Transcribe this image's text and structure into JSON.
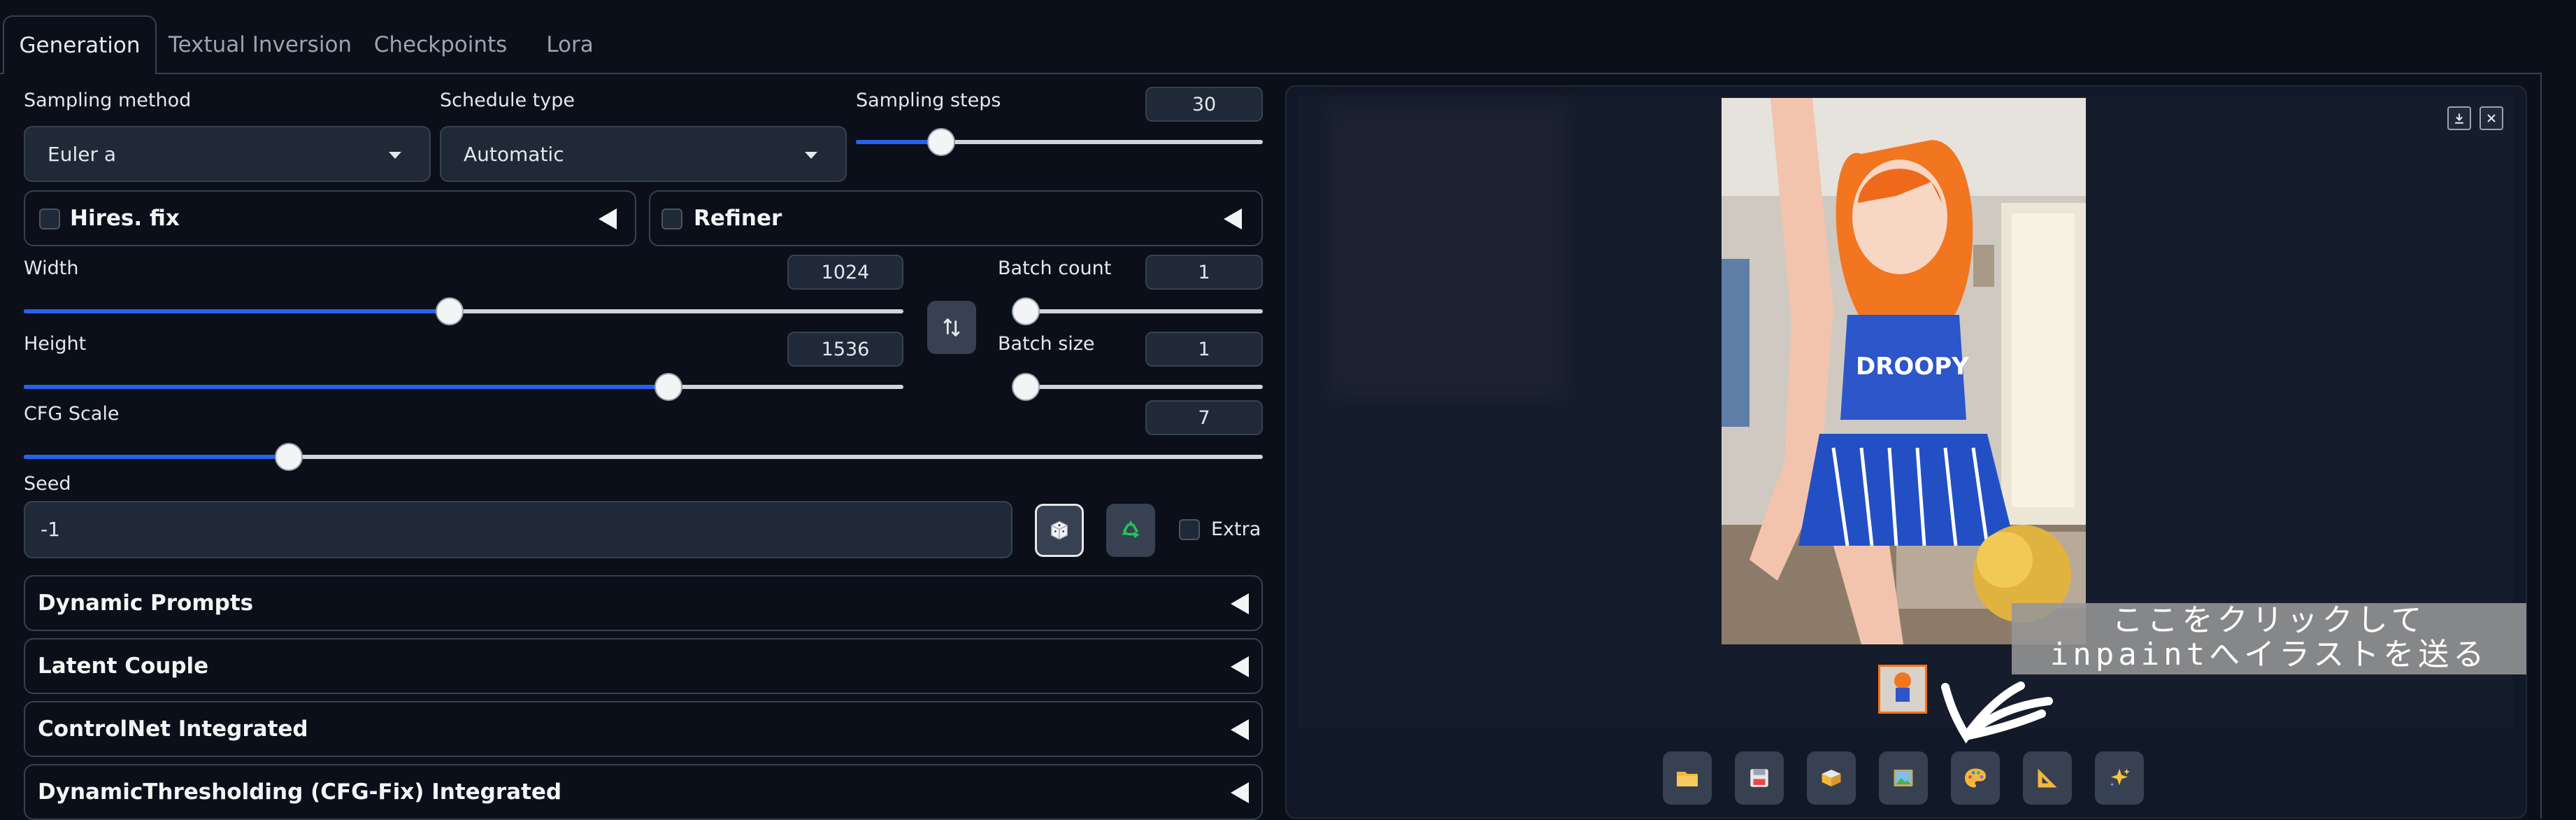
{
  "tabs": [
    {
      "label": "Generation",
      "active": true
    },
    {
      "label": "Textual Inversion",
      "active": false
    },
    {
      "label": "Checkpoints",
      "active": false
    },
    {
      "label": "Lora",
      "active": false
    }
  ],
  "sampling_method": {
    "label": "Sampling method",
    "value": "Euler a"
  },
  "schedule_type": {
    "label": "Schedule type",
    "value": "Automatic"
  },
  "sampling_steps": {
    "label": "Sampling steps",
    "value": "30",
    "fraction": 0.21
  },
  "hires_fix": {
    "label": "Hires. fix",
    "checked": false
  },
  "refiner": {
    "label": "Refiner",
    "checked": false
  },
  "width": {
    "label": "Width",
    "value": "1024",
    "fraction": 0.484
  },
  "height": {
    "label": "Height",
    "value": "1536",
    "fraction": 0.733
  },
  "batch_count": {
    "label": "Batch count",
    "value": "1",
    "fraction": 0.0
  },
  "batch_size": {
    "label": "Batch size",
    "value": "1",
    "fraction": 0.0
  },
  "swap_icon": "swap-vertical-icon",
  "cfg_scale": {
    "label": "CFG Scale",
    "value": "7",
    "fraction": 0.214
  },
  "seed": {
    "label": "Seed",
    "value": "-1"
  },
  "seed_buttons": {
    "random": "dice-icon",
    "reuse": "recycle-icon"
  },
  "extra": {
    "label": "Extra",
    "checked": false
  },
  "accordions": [
    {
      "label": "Dynamic Prompts"
    },
    {
      "label": "Latent Couple"
    },
    {
      "label": "ControlNet Integrated"
    },
    {
      "label": "DynamicThresholding (CFG-Fix) Integrated"
    }
  ],
  "gallery": {
    "image": "generated-anime-cheerleader-image",
    "shirt_text": "DROOPY",
    "download_icon": "download-icon",
    "close_icon": "close-icon"
  },
  "toolbar": [
    {
      "icon": "folder-icon"
    },
    {
      "icon": "save-icon"
    },
    {
      "icon": "zip-icon"
    },
    {
      "icon": "image-icon"
    },
    {
      "icon": "palette-icon"
    },
    {
      "icon": "ruler-triangle-icon"
    },
    {
      "icon": "sparkle-icon"
    }
  ],
  "annotation": {
    "line1": "ここをクリックして",
    "line2": "inpaintへイラストを送る"
  },
  "colors": {
    "accent": "#2563eb",
    "background": "#0b0f19",
    "panel": "#1f2937",
    "border": "#374151"
  }
}
